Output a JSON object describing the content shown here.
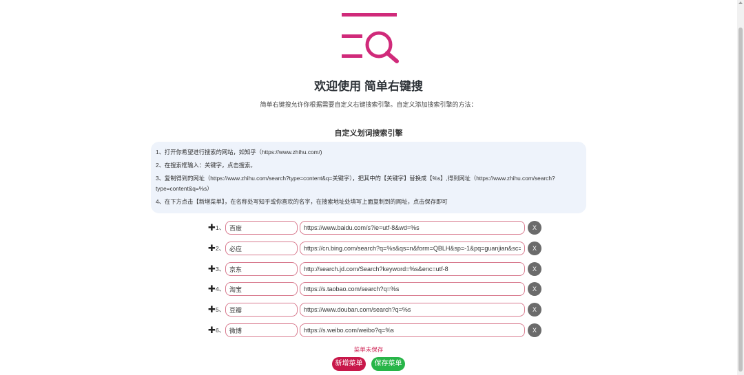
{
  "header": {
    "title": "欢迎使用 简单右键搜",
    "subtitle": "简单右键搜允许你根据需要自定义右键搜索引擎。自定义添加搜索引擎的方法："
  },
  "colors": {
    "brand": "#d02a7a",
    "add_button": "#c8184a",
    "save_button": "#28b548",
    "input_border": "#d87b8f"
  },
  "section": {
    "title": "自定义划词搜索引擎"
  },
  "instructions": [
    "1、打开你希望进行搜索的网站，如知乎（https://www.zhihu.com/)",
    "2、在搜索框输入：关键字，点击搜索。",
    "3、复制得到的网址（https://www.zhihu.com/search?type=content&q=关键字），把其中的【关键字】替换成【%s】,得到网址（https://www.zhihu.com/search?type=content&q=%s）",
    "4、在下方点击【新增菜单】，在名称处写知乎或你喜欢的名字，在搜索地址处填写上面复制到的网址，点击保存即可"
  ],
  "engines": [
    {
      "num": "1、",
      "name": "百度",
      "url": "https://www.baidu.com/s?ie=utf-8&wd=%s",
      "delete_label": "X"
    },
    {
      "num": "2、",
      "name": "必应",
      "url": "https://cn.bing.com/search?q=%s&qs=n&form=QBLH&sp=-1&pq=guanjian&sc=8-8",
      "delete_label": "X"
    },
    {
      "num": "3、",
      "name": "京东",
      "url": "http://search.jd.com/Search?keyword=%s&enc=utf-8",
      "delete_label": "X"
    },
    {
      "num": "4、",
      "name": "淘宝",
      "url": "https://s.taobao.com/search?q=%s",
      "delete_label": "X"
    },
    {
      "num": "5、",
      "name": "豆瓣",
      "url": "https://www.douban.com/search?q=%s",
      "delete_label": "X"
    },
    {
      "num": "6、",
      "name": "微博",
      "url": "https://s.weibo.com/weibo?q=%s",
      "delete_label": "X"
    }
  ],
  "status": {
    "text": "菜单未保存"
  },
  "buttons": {
    "add_label": "新增菜单",
    "save_label": "保存菜单"
  },
  "icons": {
    "drag": "move-cross-icon",
    "logo": "list-search-logo"
  }
}
